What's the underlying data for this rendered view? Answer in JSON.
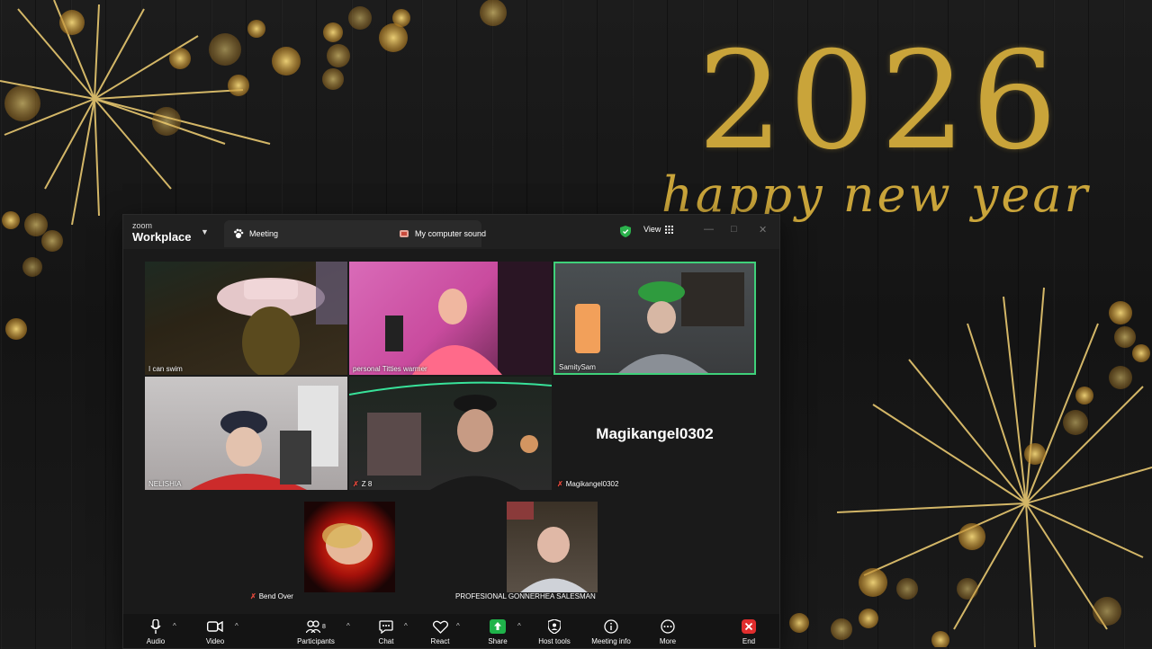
{
  "background": {
    "year": "2026",
    "greeting": "happy new year",
    "accent_color": "#c9a43a"
  },
  "app": {
    "brand_small": "zoom",
    "brand_big": "Workplace",
    "tabs": [
      {
        "label": "Meeting",
        "icon": "paw-icon"
      },
      {
        "label": "My computer sound",
        "icon": "speaker-icon"
      }
    ],
    "view_label": "View"
  },
  "participants": {
    "top_row": [
      {
        "name": "I can swim"
      },
      {
        "name": "personal Titties warmer"
      },
      {
        "name": "SamitySam",
        "active": true
      }
    ],
    "middle_row": [
      {
        "name": "NELISHIA"
      },
      {
        "name": "Z 8",
        "muted": true
      },
      {
        "name": "Magikangel0302",
        "muted": true,
        "display_name": "Magikangel0302"
      }
    ],
    "bottom_row": [
      {
        "name": "Bend Over",
        "muted": true
      },
      {
        "name": "PROFESIONAL GONNERHEA SALESMAN"
      }
    ]
  },
  "toolbar": {
    "audio": "Audio",
    "video": "Video",
    "participants": "Participants",
    "participants_count": "8",
    "chat": "Chat",
    "react": "React",
    "share": "Share",
    "host_tools": "Host tools",
    "meeting_info": "Meeting info",
    "more": "More",
    "end": "End"
  }
}
